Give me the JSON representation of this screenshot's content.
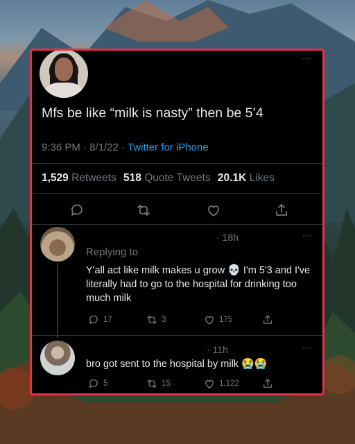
{
  "tweet": {
    "text": "Mfs be like “milk is nasty” then be 5’4",
    "time": "9:36 PM · 8/1/22 · ",
    "source": "Twitter for iPhone",
    "retweets_count": "1,529",
    "retweets_label": "Retweets",
    "quote_count": "518",
    "quote_label": "Quote Tweets",
    "likes_count": "20.1K",
    "likes_label": "Likes",
    "more": "···"
  },
  "replies": [
    {
      "time": "· 18h",
      "replying": "Replying to",
      "text_a": "Y'all act like milk makes u grow ",
      "emoji_a": "💀",
      "text_b": " I'm 5'3 and I've literally had to go to the hospital for drinking too much milk",
      "reply_count": "17",
      "retweet_count": "3",
      "like_count": "175",
      "more": "···"
    },
    {
      "time": "· 11h",
      "text_a": "bro got sent to the hospital by milk ",
      "emoji_a": "😭😭",
      "reply_count": "5",
      "retweet_count": "15",
      "like_count": "1,122",
      "more": "···"
    }
  ],
  "icons": [
    "reply-icon",
    "retweet-icon",
    "like-icon",
    "share-icon"
  ],
  "colors": {
    "border": "#e8304a",
    "link": "#1d9bf0",
    "muted": "#71767b",
    "text": "#e7e9ea"
  }
}
